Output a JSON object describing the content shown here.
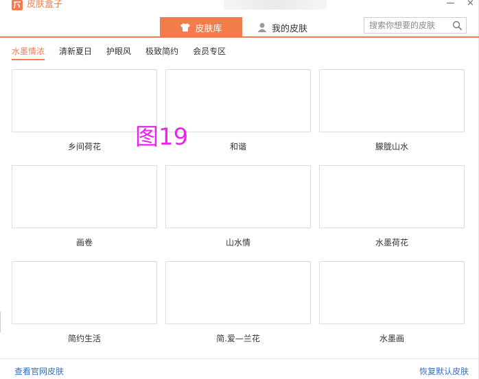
{
  "app": {
    "title": "皮肤盒子"
  },
  "main_tabs": [
    {
      "label": "皮肤库",
      "active": true
    },
    {
      "label": "我的皮肤",
      "active": false
    }
  ],
  "search": {
    "placeholder": "搜索你想要的皮肤",
    "value": ""
  },
  "category_tabs": [
    {
      "label": "水墨情浓",
      "active": true
    },
    {
      "label": "清新夏日",
      "active": false
    },
    {
      "label": "护眼风",
      "active": false
    },
    {
      "label": "极致简约",
      "active": false
    },
    {
      "label": "会员专区",
      "active": false
    }
  ],
  "skins": [
    {
      "name": "乡间荷花"
    },
    {
      "name": "和谐"
    },
    {
      "name": "朦胧山水"
    },
    {
      "name": "画卷"
    },
    {
      "name": "山水情"
    },
    {
      "name": "水墨荷花"
    },
    {
      "name": "简约生活"
    },
    {
      "name": "简.爱—兰花"
    },
    {
      "name": "水墨画"
    }
  ],
  "overlay_text": "图19",
  "footer": {
    "left_link": "查看官网皮肤",
    "right_link": "恢复默认皮肤"
  },
  "colors": {
    "accent": "#f47c4c",
    "link": "#2f6fc4",
    "overlay": "#ee22ee"
  },
  "icons": {
    "app_logo": "skin-box-logo-icon",
    "skin_library_tab": "tshirt-icon",
    "my_skins_tab": "user-icon",
    "search": "search-icon",
    "minimize": "minimize-icon",
    "close": "close-icon"
  }
}
